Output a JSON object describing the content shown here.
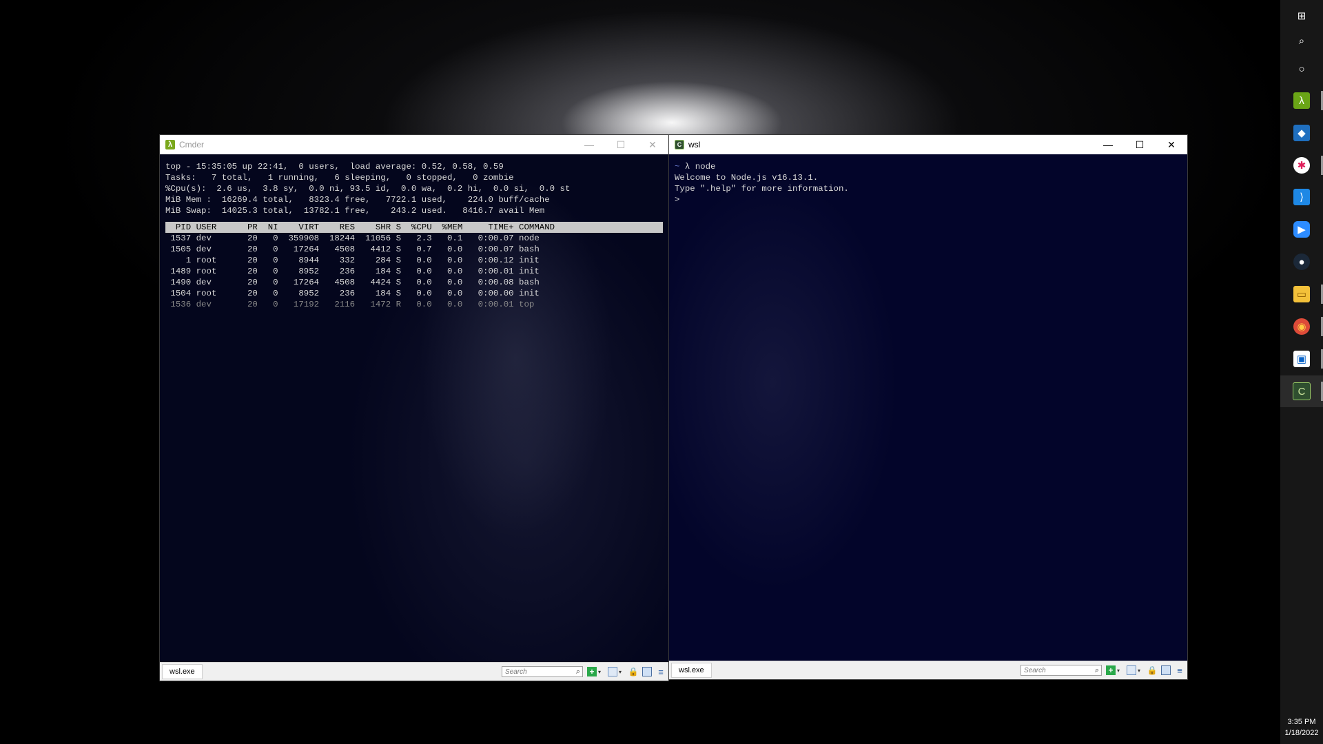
{
  "left_window": {
    "title": "Cmder",
    "minimize": "—",
    "maximize": "☐",
    "close": "✕",
    "top_lines": [
      "top - 15:35:05 up 22:41,  0 users,  load average: 0.52, 0.58, 0.59",
      "Tasks:   7 total,   1 running,   6 sleeping,   0 stopped,   0 zombie",
      "%Cpu(s):  2.6 us,  3.8 sy,  0.0 ni, 93.5 id,  0.0 wa,  0.2 hi,  0.0 si,  0.0 st",
      "MiB Mem :  16269.4 total,   8323.4 free,   7722.1 used,    224.0 buff/cache",
      "MiB Swap:  14025.3 total,  13782.1 free,    243.2 used.   8416.7 avail Mem"
    ],
    "proc_header": "  PID USER      PR  NI    VIRT    RES    SHR S  %CPU  %MEM     TIME+ COMMAND              ",
    "proc_rows": [
      " 1537 dev       20   0  359908  18244  11056 S   2.3   0.1   0:00.07 node",
      " 1505 dev       20   0   17264   4508   4412 S   0.7   0.0   0:00.07 bash",
      "    1 root      20   0    8944    332    284 S   0.0   0.0   0:00.12 init",
      " 1489 root      20   0    8952    236    184 S   0.0   0.0   0:00.01 init",
      " 1490 dev       20   0   17264   4508   4424 S   0.0   0.0   0:00.08 bash",
      " 1504 root      20   0    8952    236    184 S   0.0   0.0   0:00.00 init",
      " 1536 dev       20   0   17192   2116   1472 R   0.0   0.0   0:00.01 top"
    ],
    "status_tab": "wsl.exe",
    "search_placeholder": "Search"
  },
  "right_window": {
    "title": "wsl",
    "minimize": "—",
    "maximize": "☐",
    "close": "✕",
    "prompt_tilde": "~",
    "prompt_command": " λ node",
    "lines": [
      "Welcome to Node.js v16.13.1.",
      "Type \".help\" for more information.",
      ">"
    ],
    "status_tab": "wsl.exe",
    "search_placeholder": "Search"
  },
  "statusbar_icons": {
    "search": "⌕",
    "plus": "+",
    "caret": "▾",
    "lock": "🔒",
    "menu": "≡"
  },
  "taskbar": {
    "items": [
      {
        "name": "windows-start-icon",
        "glyph": "⊞",
        "color": "#171717"
      },
      {
        "name": "search-icon",
        "glyph": "⌕",
        "color": "#171717"
      },
      {
        "name": "cortana-icon",
        "glyph": "○",
        "color": "#171717"
      },
      {
        "name": "cmder-lambda-icon",
        "glyph": "λ",
        "color": "#6aa516"
      },
      {
        "name": "git-icon",
        "glyph": "◆",
        "color": "#1f6fbf"
      },
      {
        "name": "slack-icon",
        "glyph": "✱",
        "color": "#ffffff"
      },
      {
        "name": "vscode-icon",
        "glyph": "⟩",
        "color": "#1e88e5"
      },
      {
        "name": "zoom-icon",
        "glyph": "▶",
        "color": "#2d8cff"
      },
      {
        "name": "steam-icon",
        "glyph": "●",
        "color": "#1b2838"
      },
      {
        "name": "file-explorer-icon",
        "glyph": "▭",
        "color": "#f3c13a"
      },
      {
        "name": "chrome-icon",
        "glyph": "◉",
        "color": "#dd4b39"
      },
      {
        "name": "outlook-icon",
        "glyph": "▣",
        "color": "#ffffff"
      },
      {
        "name": "cmder-window-icon",
        "glyph": "C",
        "color": "#2f4f2f"
      }
    ],
    "time": "3:35 PM",
    "date": "1/18/2022"
  }
}
